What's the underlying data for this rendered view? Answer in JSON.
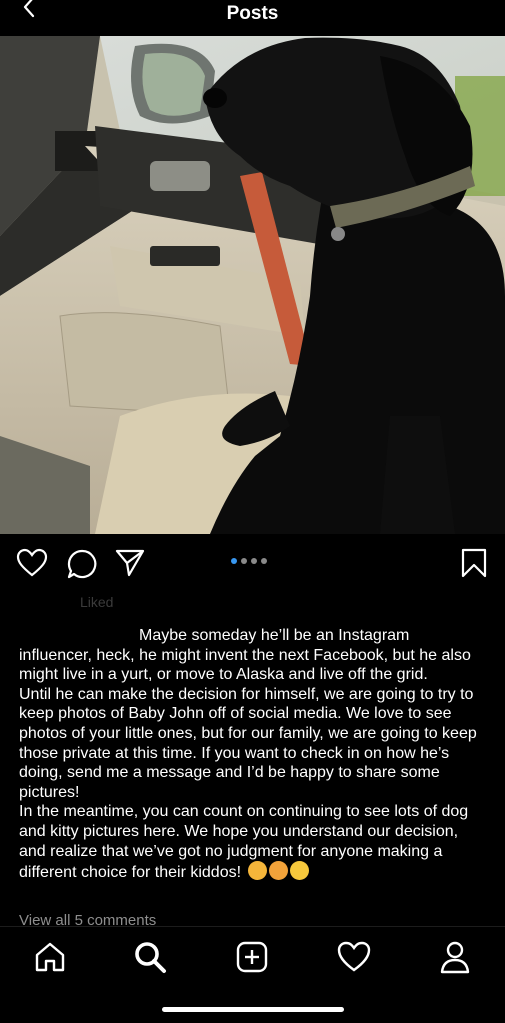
{
  "header": {
    "title": "Posts"
  },
  "post": {
    "image_alt": "Black dog sitting in the passenger seat of a car looking out the window",
    "carousel": {
      "count": 4,
      "active_index": 0
    },
    "liked_text": "Liked",
    "caption_first_line_visible": "Maybe someday he’ll be an Instagram",
    "caption_paragraphs": [
      "influencer, heck, he might invent the next Facebook, but he also might live in a yurt, or move to Alaska and live off the grid.",
      "Until he can make the decision for himself, we are going to try to keep photos of Baby John off of social media. We love to see photos of your little ones, but for our family, we are going to keep those private at this time. If you want to check in on how he’s doing, send me a message and I’d be happy to share some pictures!",
      "In the meantime, you can count on continuing to see lots of dog and kitty pictures here. We hope you understand our decision, and realize that we’ve got no judgment for anyone making a different choice for their kiddos!"
    ],
    "caption_emojis": [
      "kissing-face-emoji",
      "smiling-cat-emoji",
      "zany-face-emoji"
    ],
    "view_all_comments": "View all 5 comments"
  },
  "tabbar": {
    "items": [
      "home-icon",
      "search-icon",
      "new-post-icon",
      "activity-icon",
      "profile-icon"
    ]
  },
  "colors": {
    "background": "#000000",
    "accent": "#3897f0",
    "muted": "#8e8e8e"
  }
}
